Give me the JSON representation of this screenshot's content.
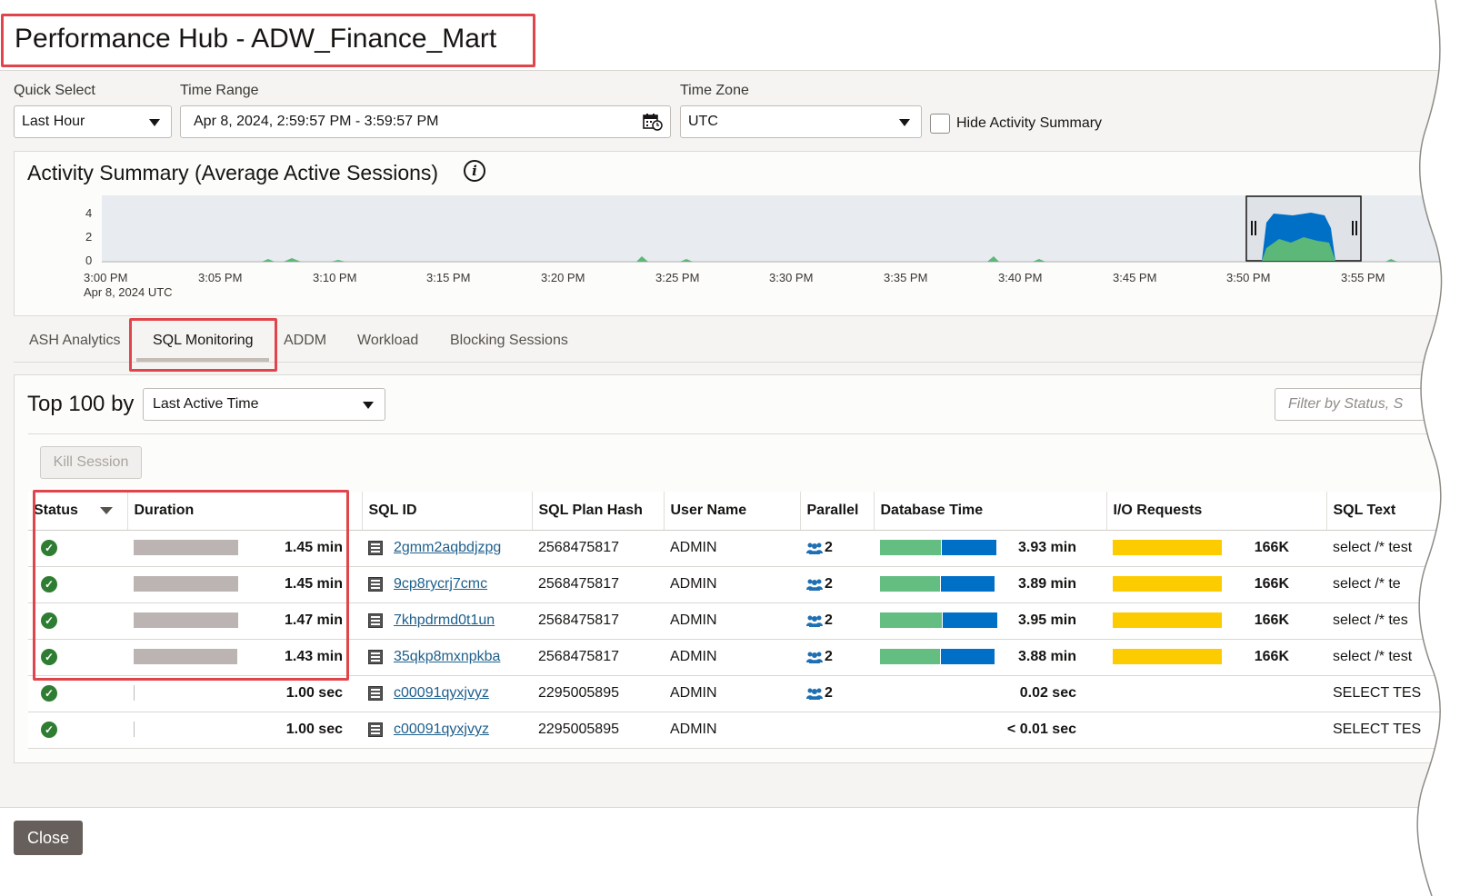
{
  "title": "Performance Hub - ADW_Finance_Mart",
  "filters": {
    "quick_select_label": "Quick Select",
    "quick_select_value": "Last Hour",
    "time_range_label": "Time Range",
    "time_range_value": "Apr 8, 2024, 2:59:57 PM - 3:59:57 PM",
    "time_zone_label": "Time Zone",
    "time_zone_value": "UTC",
    "hide_summary_label": "Hide Activity Summary",
    "hide_summary_checked": false
  },
  "activity": {
    "title": "Activity Summary (Average Active Sessions)",
    "info_glyph": "i",
    "y_ticks": [
      "4",
      "2",
      "0"
    ],
    "x_ticks": [
      "3:00 PM",
      "3:05 PM",
      "3:10 PM",
      "3:15 PM",
      "3:20 PM",
      "3:25 PM",
      "3:30 PM",
      "3:35 PM",
      "3:40 PM",
      "3:45 PM",
      "3:50 PM",
      "3:55 PM"
    ],
    "x_subtitle": "Apr 8, 2024 UTC"
  },
  "tabs": [
    "ASH Analytics",
    "SQL Monitoring",
    "ADDM",
    "Workload",
    "Blocking Sessions"
  ],
  "active_tab": "SQL Monitoring",
  "sql_monitoring": {
    "top_label": "Top 100 by",
    "top_by_value": "Last Active Time",
    "filter_placeholder": "Filter by Status, S",
    "kill_session_label": "Kill Session",
    "columns": [
      "Status",
      "Duration",
      "SQL ID",
      "SQL Plan Hash",
      "User Name",
      "Parallel",
      "Database Time",
      "I/O Requests",
      "SQL Text"
    ],
    "rows": [
      {
        "status": "completed",
        "duration": "1.45 min",
        "duration_fraction": 1.0,
        "sql_id": "2gmm2aqbdjzpg",
        "plan_hash": "2568475817",
        "user": "ADMIN",
        "parallel": "2",
        "db_time": "3.93 min",
        "db_time_fraction": 0.99,
        "io": "166K",
        "io_fraction": 1.0,
        "sql_text": "select /* test"
      },
      {
        "status": "completed",
        "duration": "1.45 min",
        "duration_fraction": 1.0,
        "sql_id": "9cp8rycrj7cmc",
        "plan_hash": "2568475817",
        "user": "ADMIN",
        "parallel": "2",
        "db_time": "3.89 min",
        "db_time_fraction": 0.98,
        "io": "166K",
        "io_fraction": 1.0,
        "sql_text": "select /* te"
      },
      {
        "status": "completed",
        "duration": "1.47 min",
        "duration_fraction": 1.0,
        "sql_id": "7khpdrmd0t1un",
        "plan_hash": "2568475817",
        "user": "ADMIN",
        "parallel": "2",
        "db_time": "3.95 min",
        "db_time_fraction": 1.0,
        "io": "166K",
        "io_fraction": 1.0,
        "sql_text": "select /* tes"
      },
      {
        "status": "completed",
        "duration": "1.43 min",
        "duration_fraction": 0.99,
        "sql_id": "35qkp8mxnpkba",
        "plan_hash": "2568475817",
        "user": "ADMIN",
        "parallel": "2",
        "db_time": "3.88 min",
        "db_time_fraction": 0.98,
        "io": "166K",
        "io_fraction": 1.0,
        "sql_text": "select /* test"
      },
      {
        "status": "completed",
        "duration": "1.00 sec",
        "duration_fraction": 0.0,
        "sql_id": "c00091qyxjvyz",
        "plan_hash": "2295005895",
        "user": "ADMIN",
        "parallel": "2",
        "db_time": "0.02 sec",
        "db_time_fraction": 0.0,
        "io": "",
        "io_fraction": 0.0,
        "sql_text": "SELECT TES"
      },
      {
        "status": "completed",
        "duration": "1.00 sec",
        "duration_fraction": 0.0,
        "sql_id": "c00091qyxjvyz",
        "plan_hash": "2295005895",
        "user": "ADMIN",
        "parallel": "",
        "db_time": "< 0.01 sec",
        "db_time_fraction": 0.0,
        "io": "",
        "io_fraction": 0.0,
        "sql_text": "SELECT TES"
      }
    ]
  },
  "footer": {
    "close_label": "Close"
  },
  "colors": {
    "highlight": "#e0454c",
    "cpu_green": "#64be82",
    "user_io_blue": "#0070c7",
    "io_yellow": "#fdcc00",
    "duration_bar": "#bcb4b2",
    "link": "#1e5f8c"
  }
}
